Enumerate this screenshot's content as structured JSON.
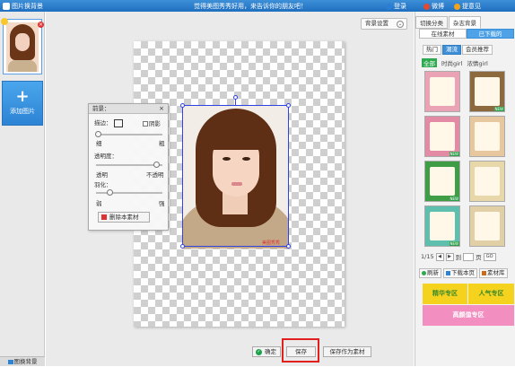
{
  "titlebar": {
    "app_name": "图片换背景",
    "slogan": "觉得美图秀秀好用，来告诉你的朋友吧！",
    "links": [
      {
        "label": "登录",
        "icon": "login-icon",
        "color": "#2a7fd4"
      },
      {
        "label": "微博",
        "icon": "weibo-icon",
        "color": "#e2492f"
      },
      {
        "label": "提意见",
        "icon": "feedback-icon",
        "color": "#f2a21b"
      }
    ]
  },
  "left": {
    "add_label": "添加图片",
    "change_bg_label": "图换背景"
  },
  "workspace": {
    "bg_settings_label": "背景设置",
    "watermark": "美图秀秀"
  },
  "panel": {
    "title": "前景：",
    "close": "×",
    "stroke_label": "描边：",
    "shadow_label": "阴影",
    "thin_label": "细",
    "thick_label": "粗",
    "opacity_label": "透明度：",
    "transparent_label": "透明",
    "opaque_label": "不透明",
    "feather_label": "羽化：",
    "weak_label": "弱",
    "strong_label": "强",
    "delete_button": "删除本素材"
  },
  "bottom": {
    "confirm_label": "确定",
    "save_label": "保存",
    "save_material_label": "保存作为素材"
  },
  "right": {
    "tabs": [
      "切换分类",
      "杂志背景"
    ],
    "material_tabs": [
      "在线素材",
      "已下载的"
    ],
    "categories": [
      "热门",
      "潮流",
      "会员推荐"
    ],
    "subcategories": [
      "全部",
      "时尚girl",
      "浓情girl"
    ],
    "pager": {
      "page_text": "1/15",
      "go_label": "到",
      "page_unit": "页",
      "go_button": "GO"
    },
    "tools": [
      "刷新",
      "下载本页",
      "素材库"
    ],
    "promos": [
      {
        "label": "精华专区",
        "bg": "#f5d21e",
        "color": "#3a8a2a"
      },
      {
        "label": "人气专区",
        "bg": "#f5d21e",
        "color": "#3a8a2a"
      },
      {
        "label": "高颜值专区",
        "bg": "#f28fc0",
        "color": "#ffffff"
      }
    ],
    "tiles": [
      {
        "color": "#e9a3b4",
        "tag": ""
      },
      {
        "color": "#8c6a3e",
        "tag": "NEW"
      },
      {
        "color": "#e38aa5",
        "tag": "NEW"
      },
      {
        "color": "#e6c79e",
        "tag": ""
      },
      {
        "color": "#3f9e45",
        "tag": "NEW"
      },
      {
        "color": "#e8d7a9",
        "tag": ""
      },
      {
        "color": "#5fbfaf",
        "tag": "NEW"
      },
      {
        "color": "#e1cfa5",
        "tag": ""
      }
    ]
  }
}
